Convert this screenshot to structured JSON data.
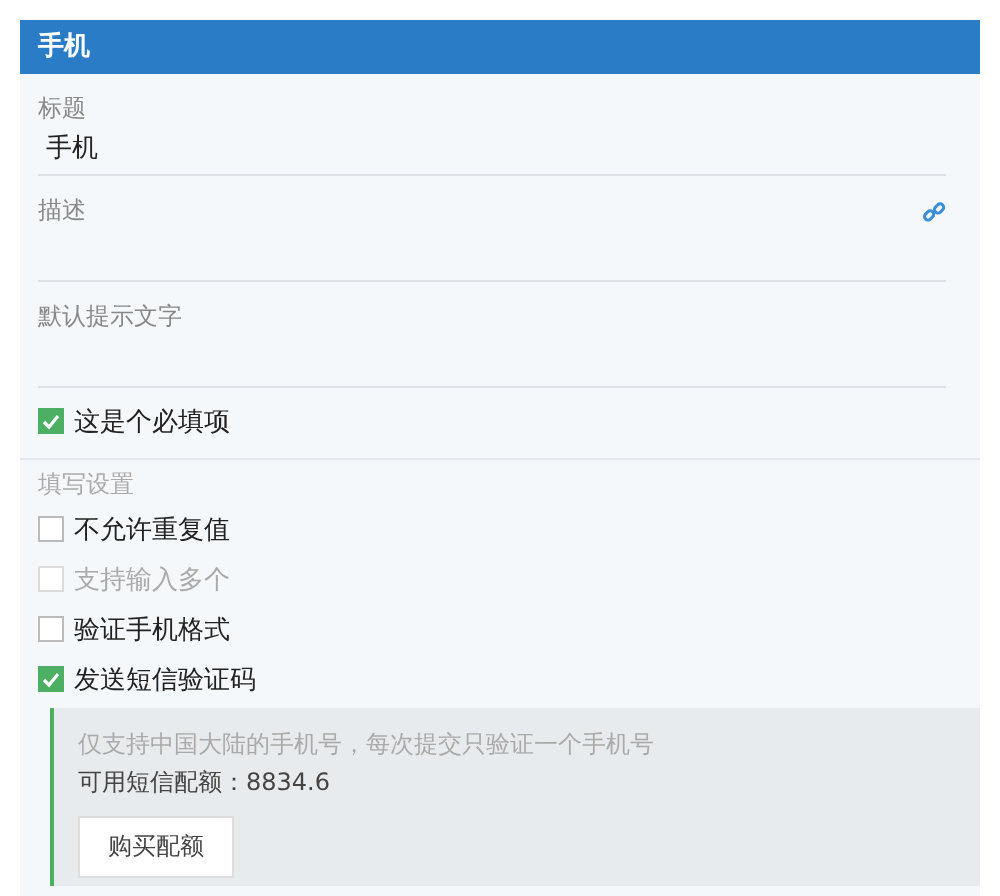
{
  "header": {
    "title": "手机"
  },
  "fields": [
    {
      "label": "标题",
      "value": "手机",
      "link_icon": false
    },
    {
      "label": "描述",
      "link_icon": true
    },
    {
      "label": "默认提示文字",
      "link_icon": false
    }
  ],
  "required": {
    "label": "这是个必填项",
    "checked": true
  },
  "settings": {
    "title": "填写设置",
    "options": [
      {
        "label": "不允许重复值",
        "checked": false,
        "disabled": false
      },
      {
        "label": "支持输入多个",
        "checked": false,
        "disabled": true
      },
      {
        "label": "验证手机格式",
        "checked": false,
        "disabled": false
      },
      {
        "label": "发送短信验证码",
        "checked": true,
        "disabled": false
      }
    ]
  },
  "sms": {
    "note": "仅支持中国大陆的手机号，每次提交只验证一个手机号",
    "quota": "可用短信配额：8834.6",
    "button": "购买配额"
  }
}
